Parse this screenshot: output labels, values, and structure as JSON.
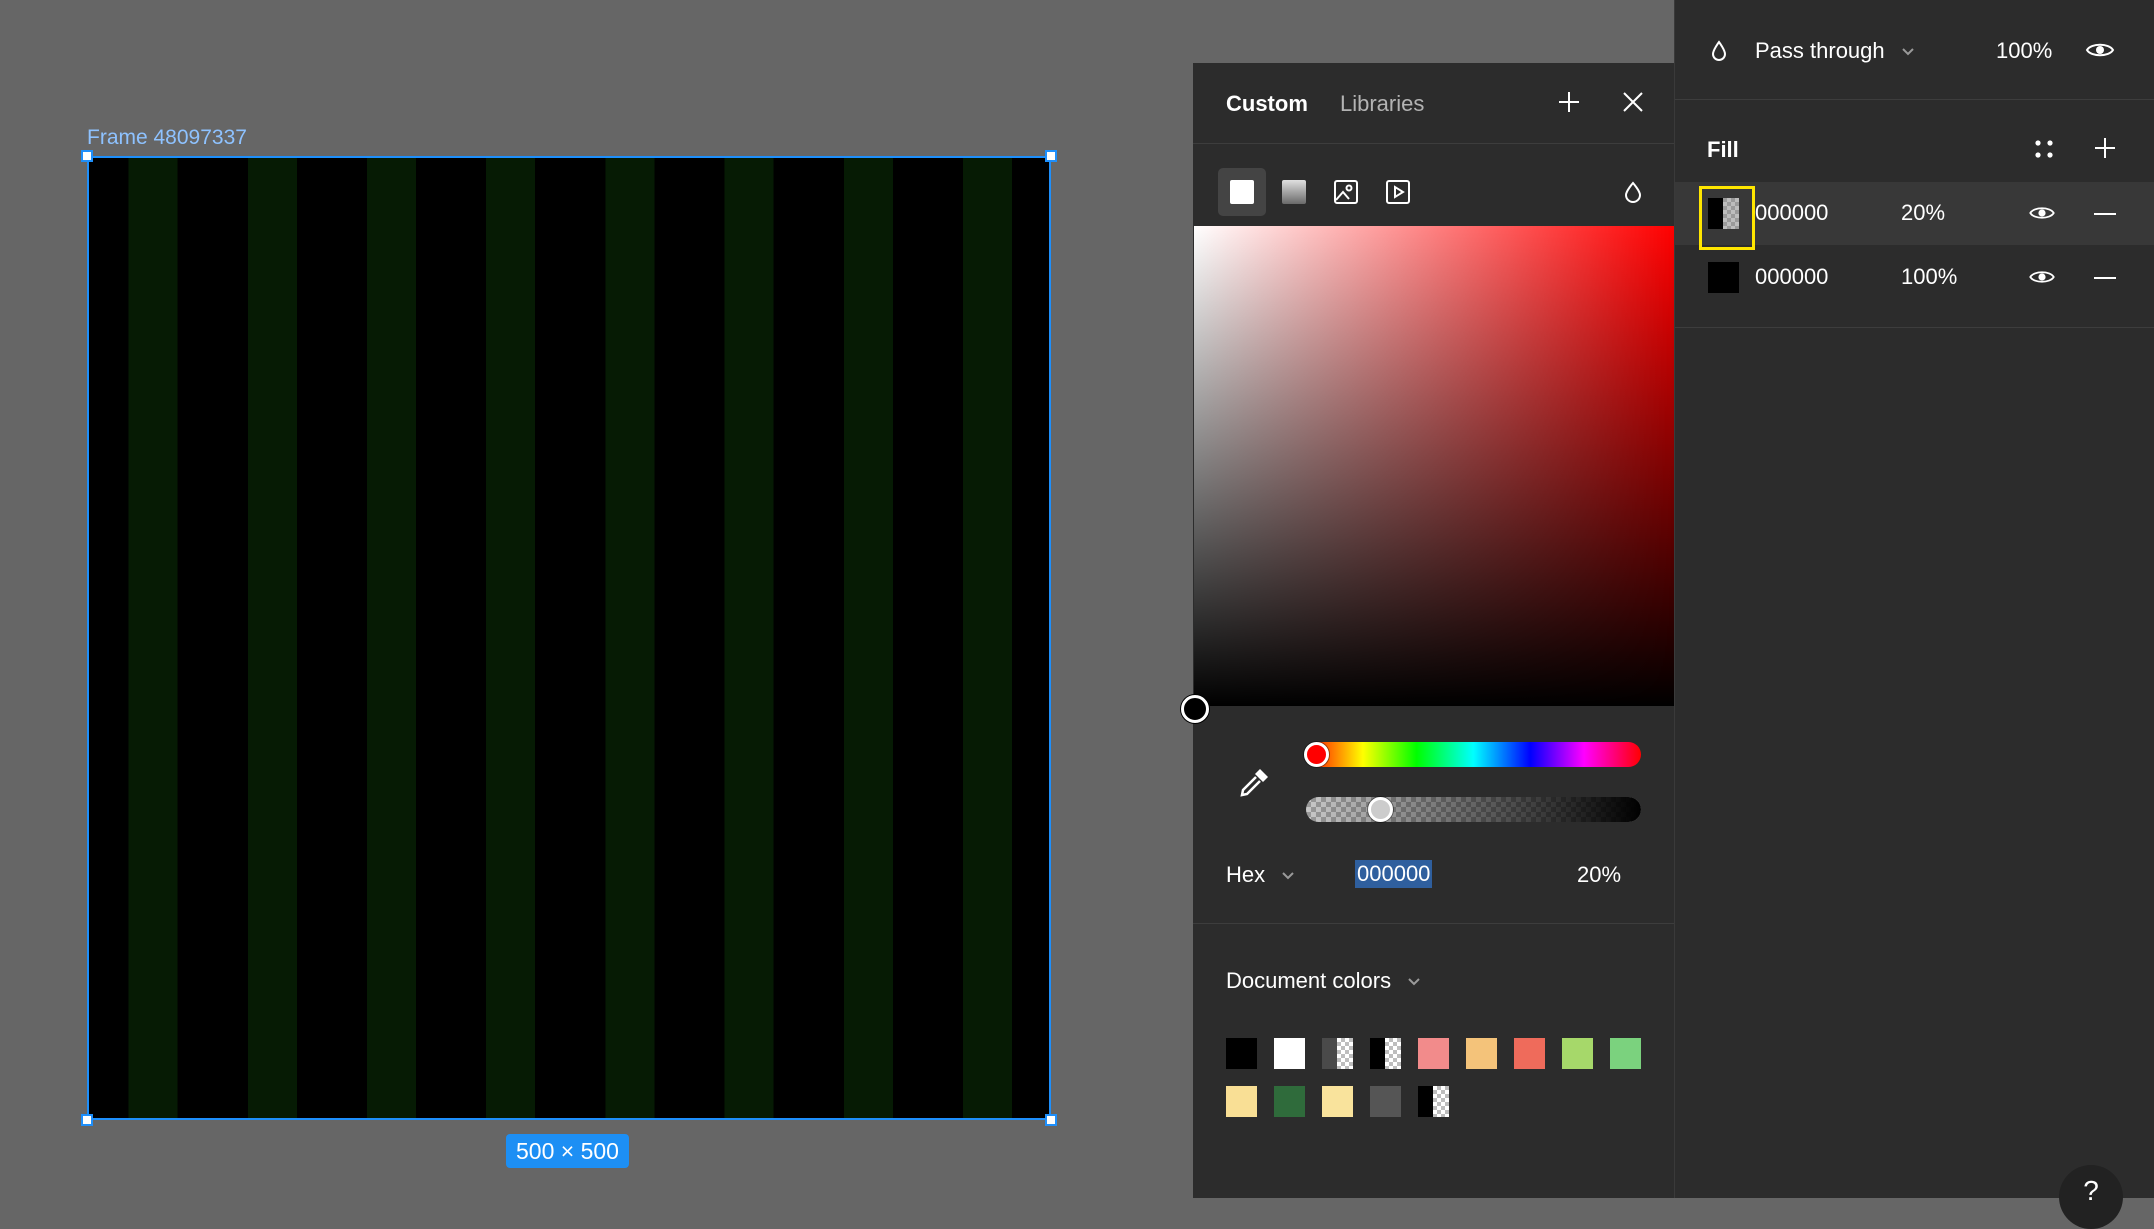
{
  "canvas": {
    "frame_label": "Frame 48097337",
    "dimension_badge": "500 × 500",
    "frame_stripe_color": "#061b04",
    "selection_color": "#1e8ffb"
  },
  "color_picker": {
    "tabs": {
      "custom": "Custom",
      "libraries": "Libraries"
    },
    "icons": [
      "plus-icon",
      "close-icon",
      "solid-fill-icon",
      "gradient-fill-icon",
      "image-fill-icon",
      "video-fill-icon",
      "opacity-drop-icon",
      "eyedropper-icon"
    ],
    "hue": "#ff0000",
    "format_label": "Hex",
    "hex_value": "000000",
    "alpha": "20%",
    "alpha_fraction": 0.2,
    "document_colors_label": "Document colors",
    "document_colors": [
      "#000000",
      "#ffffff",
      "checker-gray",
      "checker-black",
      "#f28b8b",
      "#f4c37a",
      "#ef6b5b",
      "#a6d86a",
      "#7bd27e",
      "#f9df95",
      "#2f6b3b",
      "#f9e39c",
      "#555555",
      "checker-black"
    ]
  },
  "properties": {
    "layer": {
      "blend_mode": "Pass through",
      "opacity": "100%"
    },
    "fill": {
      "title": "Fill",
      "rows": [
        {
          "hex": "000000",
          "opacity": "20%"
        },
        {
          "hex": "000000",
          "opacity": "100%"
        }
      ]
    },
    "help_label": "?"
  }
}
